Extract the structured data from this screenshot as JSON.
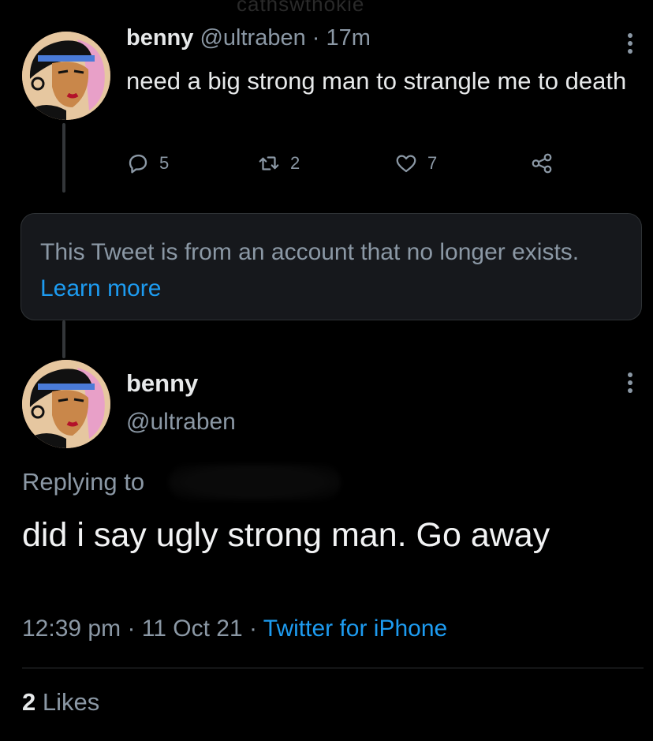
{
  "watermark": "cathswthokie",
  "tweet1": {
    "name": "benny",
    "handle": "@ultraben",
    "separator": "·",
    "time": "17m",
    "text": "need a big strong man to strangle me to death",
    "actions": {
      "replies": "5",
      "retweets": "2",
      "likes": "7"
    }
  },
  "notice": {
    "text": "This Tweet is from an account that no longer exists.",
    "link": "Learn more"
  },
  "tweet2": {
    "name": "benny",
    "handle": "@ultraben",
    "replying_to_label": "Replying to",
    "text": "did i say ugly strong man.  Go away",
    "meta": {
      "time": "12:39 pm",
      "separator": "·",
      "date": "11 Oct 21",
      "source": "Twitter for iPhone"
    },
    "likes_count": "2",
    "likes_label": "Likes"
  },
  "icons": {
    "reply": "reply-icon",
    "retweet": "retweet-icon",
    "like": "heart-icon",
    "share": "share-icon",
    "more": "more-icon"
  },
  "colors": {
    "background": "#000000",
    "text": "#e7e9ea",
    "muted": "#8b98a5",
    "link": "#1d9bf0",
    "notice_bg": "#16181c"
  }
}
